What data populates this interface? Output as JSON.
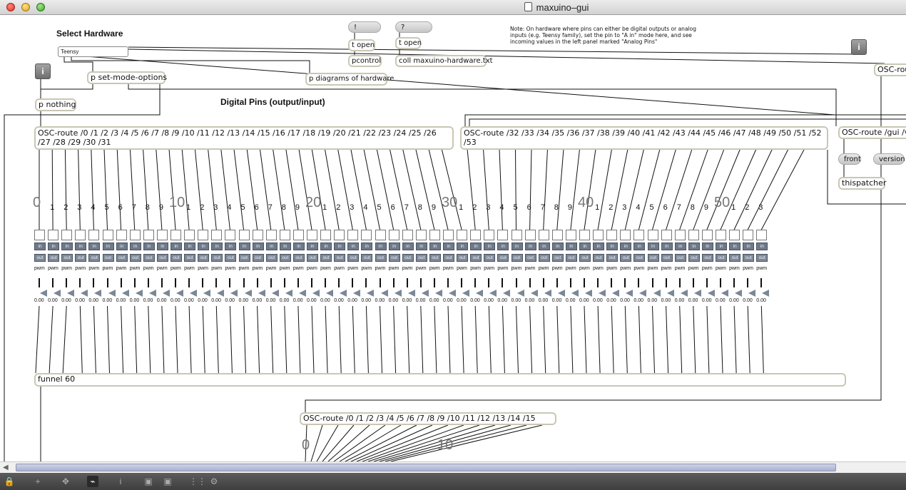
{
  "window": {
    "title": "maxuino–gui"
  },
  "colors": {
    "toggle_button": "#6e7a8a",
    "slider_triangle": "#7b8796",
    "object_border": "#c9c7b5",
    "scroll_thumb": "#aab1cf"
  },
  "labels": {
    "select_hardware": "Select Hardware",
    "digital_pins": "Digital Pins (output/input)"
  },
  "hardware_menu": {
    "value": "Teensy"
  },
  "note": "Note: On hardware where pins can either be digital outputs or analog inputs (e.g. Teensy family), set the pin to \"A in\" mode here, and see incoming values in the left panel marked \"Analog Pins\"",
  "messages": {
    "open_pcontrol": "!",
    "open_coll": "?",
    "front": "front",
    "version": "version"
  },
  "objects": {
    "t_open_1": "t open",
    "pcontrol": "pcontrol",
    "t_open_2": "t open",
    "coll": "coll maxuino-hardware.txt",
    "p_set_mode": "p set-mode-options",
    "p_diagrams": "p diagrams of hardware",
    "p_nothing": "p nothing",
    "osc_route_1": "OSC-route /0 /1 /2 /3 /4 /5 /6 /7 /8 /9 /10 /11 /12 /13 /14 /15 /16 /17 /18 /19 /20 /21 /22 /23 /24 /25 /26 /27 /28 /29 /30 /31",
    "osc_route_2": "OSC-route /32 /33 /34 /35 /36 /37 /38 /39 /40 /41 /42 /43 /44 /45 /46 /47 /48 /49 /50 /51 /52 /53",
    "osc_route_gui": "OSC-route /gui /v",
    "osc_route_top": "OSC-rou",
    "thispatcher": "thispatcher",
    "funnel": "funnel 60",
    "osc_route_analog": "OSC-route /0 /1 /2 /3 /4 /5 /6 /7 /8 /9 /10 /11 /12 /13 /14 /15"
  },
  "pins": {
    "decade_labels": [
      "0",
      "10",
      "20",
      "30",
      "40",
      "50"
    ],
    "analog_decade_labels": [
      "0",
      "10"
    ],
    "digits": [
      "1",
      "2",
      "3",
      "4",
      "5",
      "6",
      "7",
      "8",
      "9",
      "1",
      "2",
      "3",
      "4",
      "5",
      "6",
      "7",
      "8",
      "9",
      "1",
      "2",
      "3",
      "4",
      "5",
      "6",
      "7",
      "8",
      "9",
      "1",
      "2",
      "3",
      "4",
      "5",
      "6",
      "7",
      "8",
      "9",
      "1",
      "2",
      "3",
      "4",
      "5",
      "6",
      "7",
      "8",
      "9",
      "1",
      "2",
      "3",
      "4",
      "5",
      "6",
      "7",
      "8",
      "9",
      "1",
      "2",
      "3"
    ],
    "count": 54,
    "in_label": "in",
    "out_label": "out",
    "pwm_label": "pwm",
    "value": "0.00"
  }
}
